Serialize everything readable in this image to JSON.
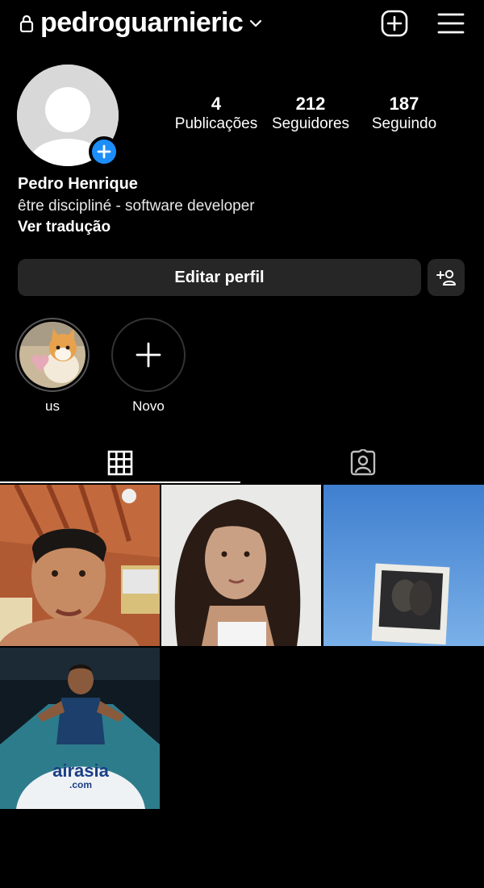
{
  "header": {
    "username": "pedroguarnieric"
  },
  "profile": {
    "posts_count": "4",
    "posts_label": "Publicações",
    "followers_count": "212",
    "followers_label": "Seguidores",
    "following_count": "187",
    "following_label": "Seguindo",
    "name": "Pedro Henrique",
    "bio": "être discipliné - software developer",
    "translate_link": "Ver tradução"
  },
  "actions": {
    "edit_profile": "Editar perfil"
  },
  "highlights": [
    {
      "label": "us"
    },
    {
      "label": "Novo"
    }
  ],
  "tile_texts": {
    "ad_brand": "airasia",
    "ad_domain": ".com"
  },
  "icons": {
    "lock": "lock-icon",
    "chevron": "chevron-down-icon",
    "add_post": "add-post-icon",
    "menu": "hamburger-menu-icon",
    "avatar_add": "plus-icon",
    "add_friend": "add-person-icon",
    "grid_tab": "grid-icon",
    "tagged_tab": "tagged-person-icon"
  },
  "colors": {
    "background": "#000000",
    "button": "#262626",
    "accent": "#1c8ef9"
  }
}
